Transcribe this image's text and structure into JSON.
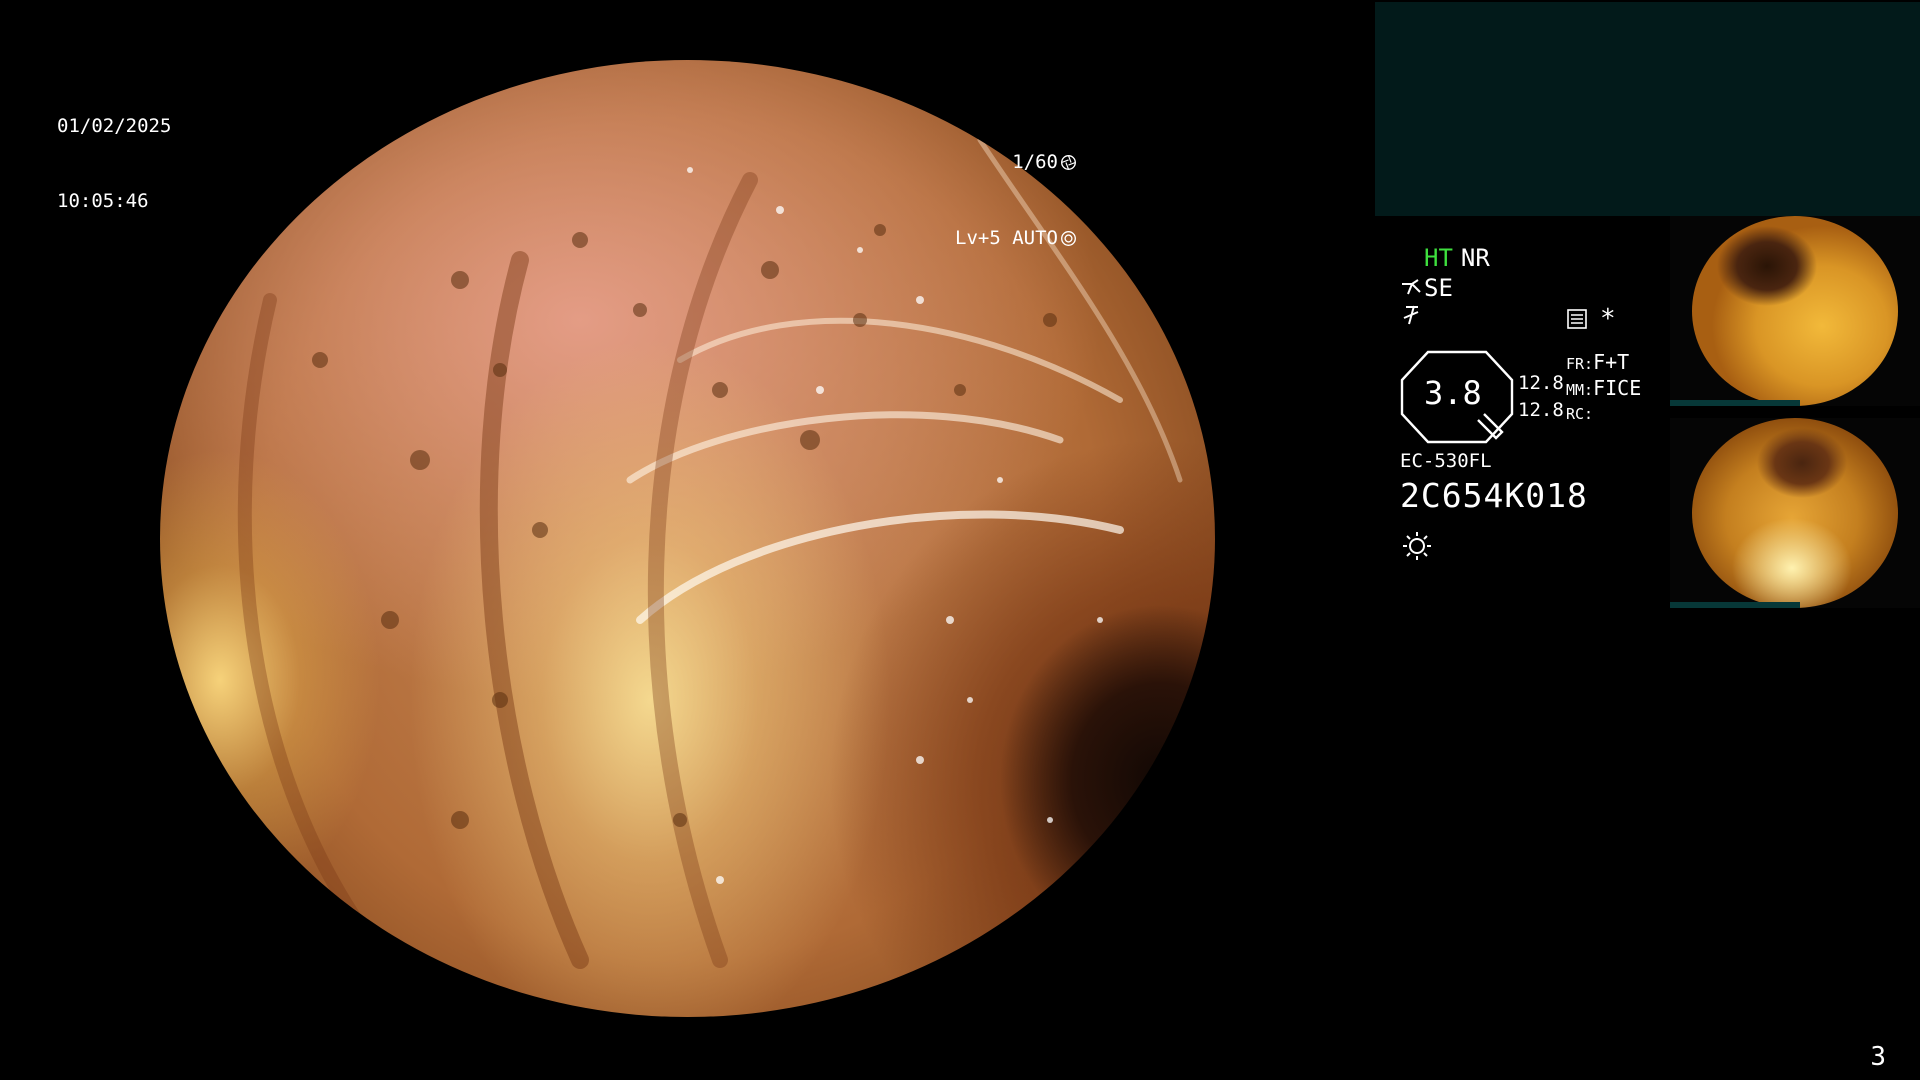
{
  "overlay": {
    "date": "01/02/2025",
    "time": "10:05:46",
    "shutter": "1/60",
    "iris": "Lv+5 AUTO"
  },
  "status": {
    "ht": "HT",
    "nr": "NR",
    "se": "SE",
    "zoom_value": "3.8",
    "val1": "12.8",
    "val2": "12.8",
    "fr_label": "FR:",
    "fr_value": "F+T",
    "mm_label": "MM:",
    "mm_value": "FICE",
    "rc_label": "RC:",
    "star": "*",
    "scope_model": "EC-530FL",
    "scope_serial": "2C654K018"
  },
  "colors": {
    "ht_color": "#3ee03e",
    "panel_bg": "#021a1a"
  },
  "icons": [
    "shutter-icon",
    "iris-icon",
    "scope-icon",
    "flash-icon",
    "menu-icon",
    "octagon-icon",
    "light-icon"
  ],
  "thumbnails": [
    {
      "name": "thumbnail-1"
    },
    {
      "name": "thumbnail-2"
    }
  ],
  "page_number": "3"
}
